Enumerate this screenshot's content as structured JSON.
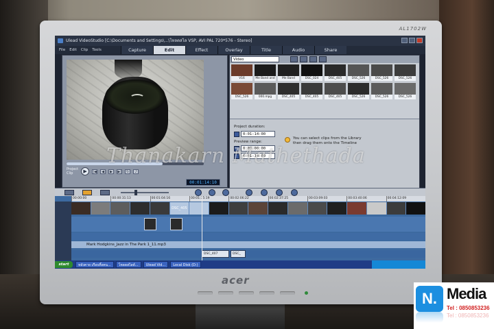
{
  "monitor": {
    "model": "AL1702W",
    "brand": "acer"
  },
  "window": {
    "title": "Ulead VideoStudio [C:\\Documents and Settings\\...\\โหลดสไล VSP, AVI PAL 720*576 - Stereo]"
  },
  "menu": {
    "items": [
      "File",
      "Edit",
      "Clip",
      "Tools"
    ]
  },
  "steps": [
    {
      "label": "Capture",
      "active": false
    },
    {
      "label": "Edit",
      "active": true
    },
    {
      "label": "Effect",
      "active": false
    },
    {
      "label": "Overlay",
      "active": false
    },
    {
      "label": "Title",
      "active": false
    },
    {
      "label": "Audio",
      "active": false
    },
    {
      "label": "Share",
      "active": false
    }
  ],
  "preview": {
    "project_label": "Project",
    "clip_label": "Clip",
    "timecode": "00:01:14:10"
  },
  "library": {
    "category": "Video",
    "thumbnails": [
      {
        "caption": "V16",
        "tone": "#6b3b2a"
      },
      {
        "caption": "Me Band and",
        "tone": "#1b1b1b"
      },
      {
        "caption": "Me Band",
        "tone": "#202020"
      },
      {
        "caption": "DSC_024",
        "tone": "#111111"
      },
      {
        "caption": "DSC_405",
        "tone": "#2a2a2a"
      },
      {
        "caption": "DSC_526",
        "tone": "#555555"
      },
      {
        "caption": "DSC_526",
        "tone": "#4a4a4a"
      },
      {
        "caption": "DSC_526",
        "tone": "#3c3c3c"
      },
      {
        "caption": "DSC_526",
        "tone": "#7a4a36"
      },
      {
        "caption": "000.mpg",
        "tone": "#5a5a5a"
      },
      {
        "caption": "DSC_405",
        "tone": "#2e2e2e"
      },
      {
        "caption": "DSC_405",
        "tone": "#3a3a3a"
      },
      {
        "caption": "DSC_405",
        "tone": "#4d4d4d"
      },
      {
        "caption": "DSC_526",
        "tone": "#2c2c2c"
      },
      {
        "caption": "DSC_526",
        "tone": "#5b5b5b"
      },
      {
        "caption": "DSC_526",
        "tone": "#6a6a6a"
      }
    ]
  },
  "options": {
    "project_duration_label": "Project duration:",
    "project_duration": "0:01:14:00",
    "preview_range_label": "Preview range:",
    "preview_start": "0:00:00:00",
    "preview_end": "0:01:14:00",
    "hint": "You can select clips from the Library then drag them onto the Timeline"
  },
  "timeline": {
    "ruler": [
      "00:00:00",
      "00:00:31:13",
      "00:01:04:16",
      "00:01:35:19",
      "00:02:06:22",
      "00:02:37:25",
      "00:03:09:03",
      "00:03:40:06",
      "00:04:12:09"
    ],
    "video_clips": [
      "#3b2c24",
      "#7c7c7c",
      "#5d5d5d",
      "#2d2d2d",
      "#3a3a3a",
      "#b5c8e0",
      "#b5c8e0",
      "#1b1b1b",
      "#3e3e3e",
      "#5b4438",
      "#2a2a2a",
      "#6b6b6b",
      "#4a4a4a",
      "#1f1f1f",
      "#7a3a30",
      "#c9c9c9",
      "#3c3c3c",
      "#111111"
    ],
    "video_clip_labels": [
      "DSC_405"
    ],
    "audio_clip": "Mark Hodgkins_Jazz in The Park 1_11.mp3",
    "markers": [
      "DSC_407",
      "DSC_"
    ]
  },
  "taskbar": {
    "start": "start",
    "tasks": [
      "หลังคาย เกือบทิ้งคน...",
      "โหลดสไลด์...",
      "Ulead Vid...",
      "Local Disk (D:)"
    ]
  },
  "watermark": "Thanakarn Mathethada",
  "logo": {
    "letter": "N.",
    "word": "Media",
    "tel": "Tel : 0850853236"
  }
}
